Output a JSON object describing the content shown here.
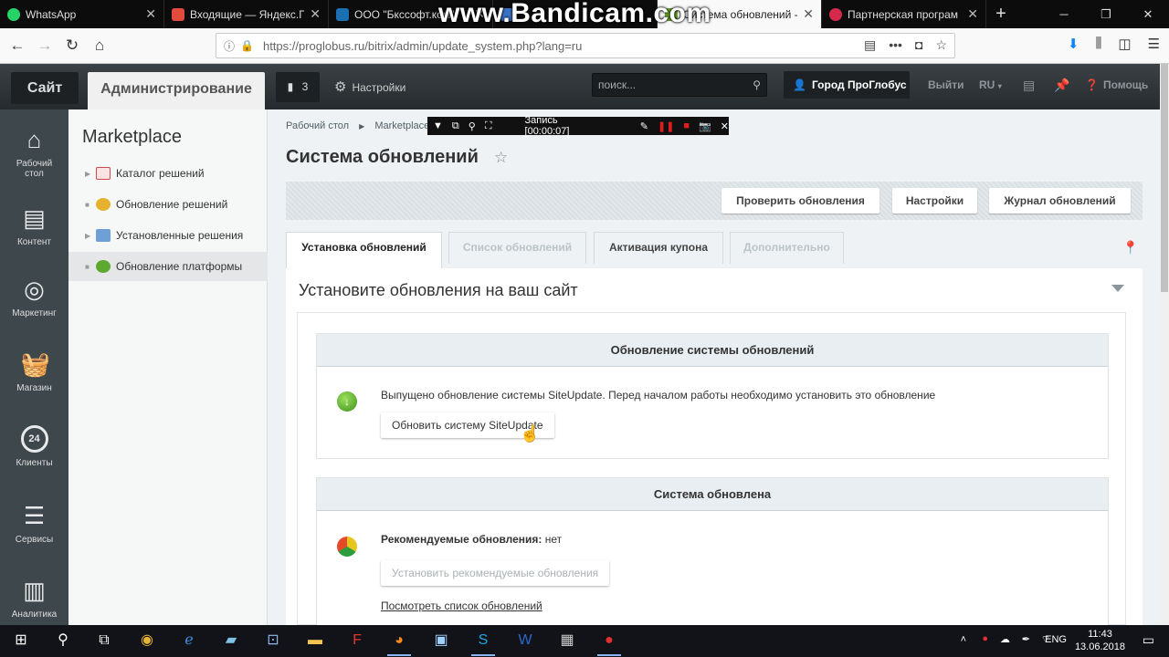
{
  "browser": {
    "tabs": [
      {
        "label": "WhatsApp",
        "color": "#25d366"
      },
      {
        "label": "Входящие — Яндекс.По",
        "color": "#e34b3c"
      },
      {
        "label": "ООО \"Бкссофт.ком\"",
        "color": "#1b6fb3"
      },
      {
        "label": "",
        "color": "#3a70c6"
      },
      {
        "label": "Система обновлений - ",
        "color": "#6aa32c"
      },
      {
        "label": "Партнерская програм",
        "color": "#d52a4c"
      }
    ],
    "url": "https://proglobus.ru/bitrix/admin/update_system.php?lang=ru",
    "watermark": "www.Bandicam.com"
  },
  "panel": {
    "site_label": "Сайт",
    "admin_label": "Администрирование",
    "notifications_count": "3",
    "settings_label": "Настройки",
    "search_placeholder": "поиск...",
    "user_label": "Город ПроГлобус",
    "logout_label": "Выйти",
    "lang_label": "RU",
    "help_label": "Помощь"
  },
  "iconbar": [
    {
      "label": "Рабочий\nстол",
      "icon": "home-icon"
    },
    {
      "label": "Контент",
      "icon": "document-icon"
    },
    {
      "label": "Маркетинг",
      "icon": "target-icon"
    },
    {
      "label": "Магазин",
      "icon": "basket-icon"
    },
    {
      "label": "Клиенты",
      "icon": "clients-24-icon"
    },
    {
      "label": "Сервисы",
      "icon": "layers-icon"
    },
    {
      "label": "Аналитика",
      "icon": "chart-icon"
    }
  ],
  "sidebar": {
    "title": "Marketplace",
    "items": [
      {
        "label": "Каталог решений"
      },
      {
        "label": "Обновление решений"
      },
      {
        "label": "Установленные решения"
      },
      {
        "label": "Обновление платформы"
      }
    ]
  },
  "main": {
    "breadcrumbs": [
      "Рабочий стол",
      "Marketplace"
    ],
    "recorder_label": "Запись [00:00:07]",
    "title": "Система обновлений",
    "toolbar": {
      "check": "Проверить обновления",
      "settings": "Настройки",
      "journal": "Журнал обновлений"
    },
    "tabs": [
      {
        "label": "Установка обновлений"
      },
      {
        "label": "Список обновлений"
      },
      {
        "label": "Активация купона"
      },
      {
        "label": "Дополнительно"
      }
    ],
    "panel_title": "Установите обновления на ваш сайт",
    "box1": {
      "header": "Обновление системы обновлений",
      "text": "Выпущено обновление системы SiteUpdate. Перед началом работы необходимо установить это обновление",
      "button": "Обновить систему SiteUpdate"
    },
    "box2": {
      "header": "Система обновлена",
      "recommended_label": "Рекомендуемые обновления:",
      "recommended_value": "нет",
      "button": "Установить рекомендуемые обновления",
      "link": "Посмотреть список обновлений"
    }
  },
  "taskbar": {
    "lang": "ENG",
    "time": "11:43",
    "date": "13.06.2018"
  }
}
